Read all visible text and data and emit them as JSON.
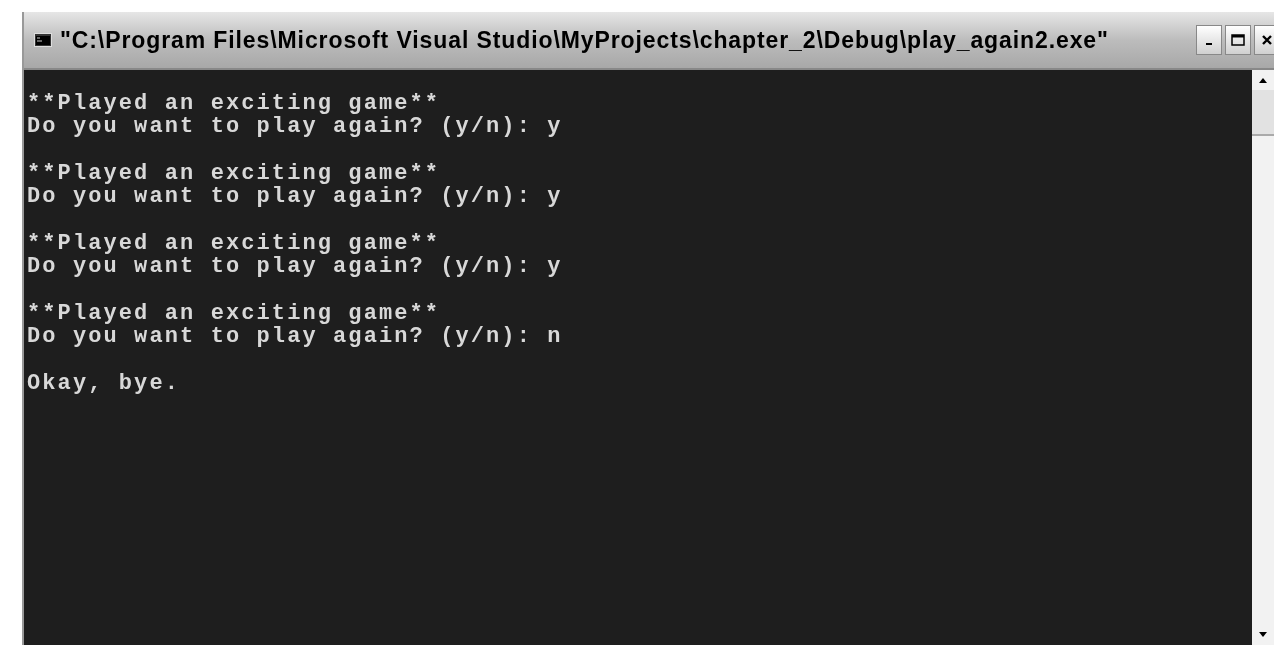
{
  "window": {
    "title": "\"C:\\Program Files\\Microsoft Visual Studio\\MyProjects\\chapter_2\\Debug\\play_again2.exe\""
  },
  "console": {
    "blocks": [
      {
        "lines": [
          "**Played an exciting game**",
          "Do you want to play again? (y/n): y"
        ]
      },
      {
        "lines": [
          "**Played an exciting game**",
          "Do you want to play again? (y/n): y"
        ]
      },
      {
        "lines": [
          "**Played an exciting game**",
          "Do you want to play again? (y/n): y"
        ]
      },
      {
        "lines": [
          "**Played an exciting game**",
          "Do you want to play again? (y/n): n"
        ]
      },
      {
        "lines": [
          "Okay, bye."
        ]
      }
    ]
  }
}
